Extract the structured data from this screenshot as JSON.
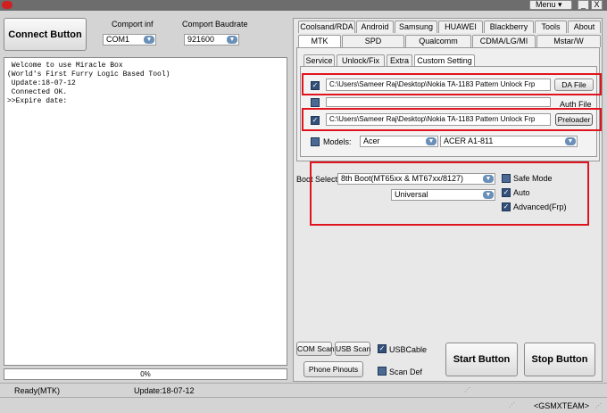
{
  "titlebar": {
    "menu_label": "Menu ▾",
    "minimize": "_",
    "close": "X"
  },
  "left": {
    "connect_label": "Connect Button",
    "comport_label": "Comport inf",
    "comport_value": "COM1",
    "baud_label": "Comport Baudrate",
    "baud_value": "921600",
    "log_lines": [
      " Welcome to use Miracle Box",
      "(World's First Furry Logic Based Tool)",
      " Update:18-07-12",
      " Connected OK.",
      ">>Expire date:"
    ],
    "progress_text": "0%"
  },
  "tabs_row1": [
    "Coolsand/RDA",
    "Android",
    "Samsung",
    "HUAWEI",
    "Blackberry",
    "Tools",
    "About"
  ],
  "tabs_row2": [
    "MTK",
    "SPD",
    "Qualcomm",
    "CDMA/LG/MI",
    "Mstar/W"
  ],
  "subtabs": [
    "Service",
    "Unlock/Fix",
    "Extra",
    "Custom Setting"
  ],
  "files": {
    "da_path": "C:\\Users\\Sameer Raj\\Desktop\\Nokia TA-1183 Pattern Unlock Frp",
    "da_button": "DA File",
    "auth_path": "",
    "auth_button": "Auth File",
    "preloader_path": "C:\\Users\\Sameer Raj\\Desktop\\Nokia TA-1183 Pattern Unlock Frp",
    "preloader_button": "Preloader",
    "models_label": "Models:",
    "brand_value": "Acer",
    "model_value": "ACER A1-811"
  },
  "boot": {
    "select_label": "Boot Select",
    "boot_value": "8th Boot(MT65xx & MT67xx/8127)",
    "mode_value": "Universal",
    "safe_mode": "Safe Mode",
    "auto": "Auto",
    "advanced": "Advanced(Frp)"
  },
  "bottom_controls": {
    "com_scan": "COM Scan",
    "usb_scan": "USB Scan",
    "usb_cable": "USBCable",
    "phone_pinouts": "Phone Pinouts",
    "scan_def": "Scan Def",
    "start": "Start Button",
    "stop": "Stop Button"
  },
  "status": {
    "ready": "Ready(MTK)",
    "update": "Update:18-07-12",
    "team": "<GSMXTEAM>"
  },
  "colors": {
    "highlight": "#e0141e",
    "checkbox": "#33507a"
  }
}
